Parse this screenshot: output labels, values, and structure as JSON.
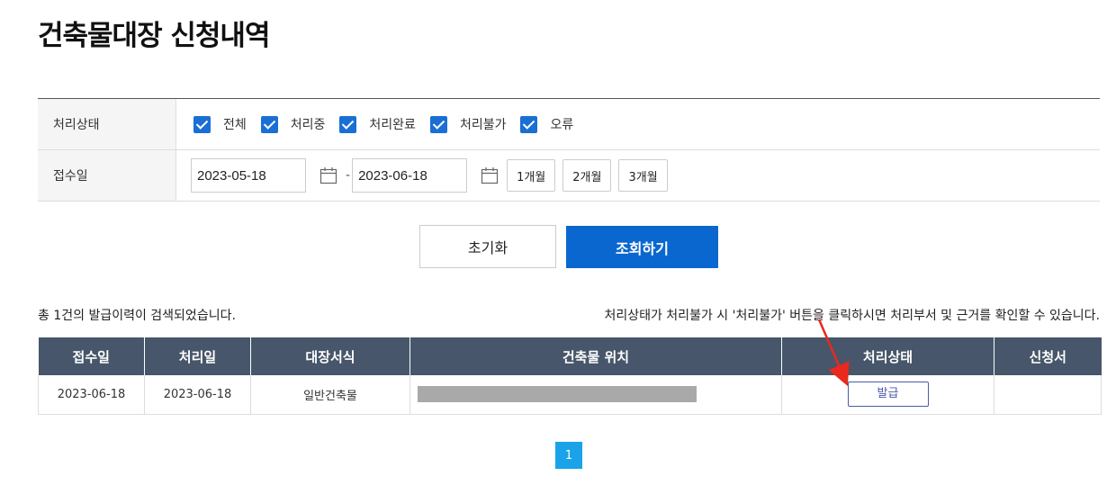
{
  "page": {
    "title": "건축물대장 신청내역"
  },
  "filters": {
    "status_label": "처리상태",
    "status_options": [
      {
        "label": "전체",
        "checked": true
      },
      {
        "label": "처리중",
        "checked": true
      },
      {
        "label": "처리완료",
        "checked": true
      },
      {
        "label": "처리불가",
        "checked": true
      },
      {
        "label": "오류",
        "checked": true
      }
    ],
    "date_label": "접수일",
    "date_from": "2023-05-18",
    "date_separator": "-",
    "date_to": "2023-06-18",
    "period_buttons": [
      "1개월",
      "2개월",
      "3개월"
    ]
  },
  "actions": {
    "reset_label": "초기화",
    "search_label": "조회하기"
  },
  "results": {
    "count_text": "총 1건의 발급이력이 검색되었습니다.",
    "note_text": "처리상태가 처리불가 시 '처리불가' 버튼을 클릭하시면 처리부서 및 근거를 확인할 수 있습니다."
  },
  "table": {
    "headers": [
      "접수일",
      "처리일",
      "대장서식",
      "건축물 위치",
      "처리상태",
      "신청서"
    ],
    "rows": [
      {
        "received": "2023-06-18",
        "processed": "2023-06-18",
        "form": "일반건축물",
        "location": "",
        "status": "발급",
        "application": ""
      }
    ]
  },
  "pagination": {
    "current": "1"
  },
  "colors": {
    "accent": "#0a67d0",
    "header_bg": "#47566a",
    "checkbox": "#1a6fd4",
    "page_active": "#1aa3e8",
    "annotation_arrow": "#e8291c"
  }
}
